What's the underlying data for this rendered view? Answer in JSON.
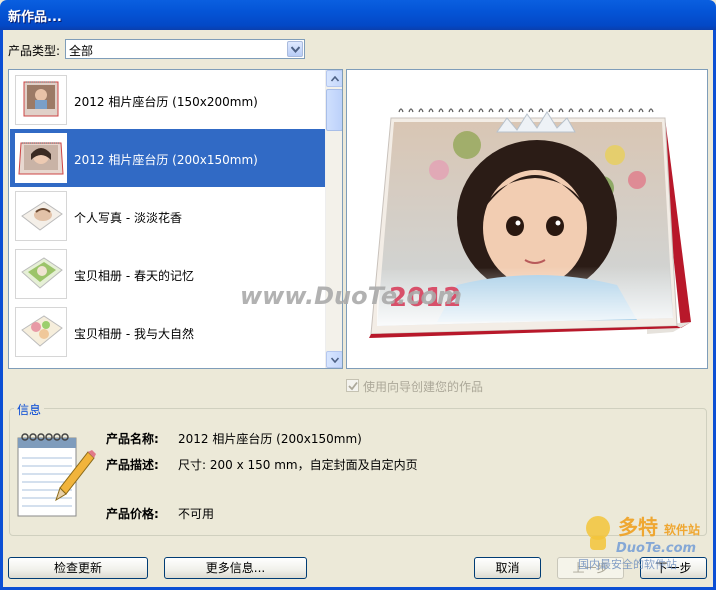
{
  "window": {
    "title": "新作品..."
  },
  "filter": {
    "label": "产品类型:",
    "selected": "全部"
  },
  "products": [
    {
      "label": "2012 相片座台历 (150x200mm)",
      "selected": false,
      "thumb": "desk-calendar-portrait"
    },
    {
      "label": "2012 相片座台历 (200x150mm)",
      "selected": true,
      "thumb": "desk-calendar-landscape"
    },
    {
      "label": "个人写真 - 淡淡花香",
      "selected": false,
      "thumb": "photo-book"
    },
    {
      "label": "宝贝相册 - 春天的记忆",
      "selected": false,
      "thumb": "photo-book-green"
    },
    {
      "label": "宝贝相册 - 我与大自然",
      "selected": false,
      "thumb": "photo-book-nature"
    }
  ],
  "preview": {
    "calendar_year": "2012",
    "watermark": "www.DuoTe.com"
  },
  "wizard": {
    "label": "使用向导创建您的作品",
    "checked": true,
    "enabled": false
  },
  "info": {
    "title": "信息",
    "name_key": "产品名称:",
    "name_val": "2012 相片座台历 (200x150mm)",
    "desc_key": "产品描述:",
    "desc_val": "尺寸: 200 x 150 mm，自定封面及自定内页",
    "price_key": "产品价格:",
    "price_val": "不可用"
  },
  "buttons": {
    "check_updates": "检查更新",
    "more_info": "更多信息...",
    "cancel": "取消",
    "back": "上一步",
    "next": "下一步"
  },
  "logo": {
    "brand": "多特",
    "sub": "软件站",
    "domain": "DuoTe.com",
    "tagline": "国内最安全的软件站"
  },
  "colors": {
    "title_bar": "#0454d6",
    "selection": "#316ac5",
    "dialog_bg": "#ece9d8",
    "group_title": "#0046d5"
  }
}
